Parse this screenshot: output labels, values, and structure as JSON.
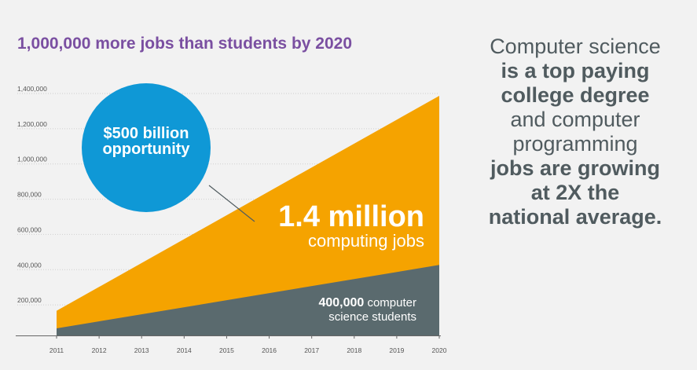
{
  "chart_data": {
    "type": "area",
    "title": "1,000,000 more jobs than students by 2020",
    "x": [
      2011,
      2012,
      2013,
      2014,
      2015,
      2016,
      2017,
      2018,
      2019,
      2020
    ],
    "x_tick_labels": [
      "2011",
      "2012",
      "2013",
      "2014",
      "2015",
      "2016",
      "2017",
      "2018",
      "2019",
      "2020"
    ],
    "y_tick_labels": [
      "200,000",
      "400,000",
      "600,000",
      "800,000",
      "1,000,000",
      "1,200,000",
      "1,400,000"
    ],
    "ylim": [
      0,
      1400000
    ],
    "series": [
      {
        "name": "computing jobs",
        "start": 140000,
        "end": 1360000,
        "color": "#f5a300"
      },
      {
        "name": "computer science students",
        "start": 40000,
        "end": 400000,
        "color": "#5a6a6e"
      }
    ],
    "annotations": {
      "bubble_line1": "$500 billion",
      "bubble_line2": "opportunity",
      "bubble_color": "#0f98d6",
      "jobs_value": "1.4 million",
      "jobs_label": "computing jobs",
      "students_value": "400,000",
      "students_label_1": "computer",
      "students_label_2": "science students"
    }
  },
  "side_text": {
    "line1": "Computer science",
    "line2": "is a top paying",
    "line3": "college degree",
    "line4": "and computer",
    "line5": "programming",
    "line6": "jobs are growing",
    "line7": "at 2X the",
    "line8": "national average."
  },
  "colors": {
    "title": "#7a4fa1",
    "side_text": "#505b5f",
    "background": "#f2f2f2"
  }
}
